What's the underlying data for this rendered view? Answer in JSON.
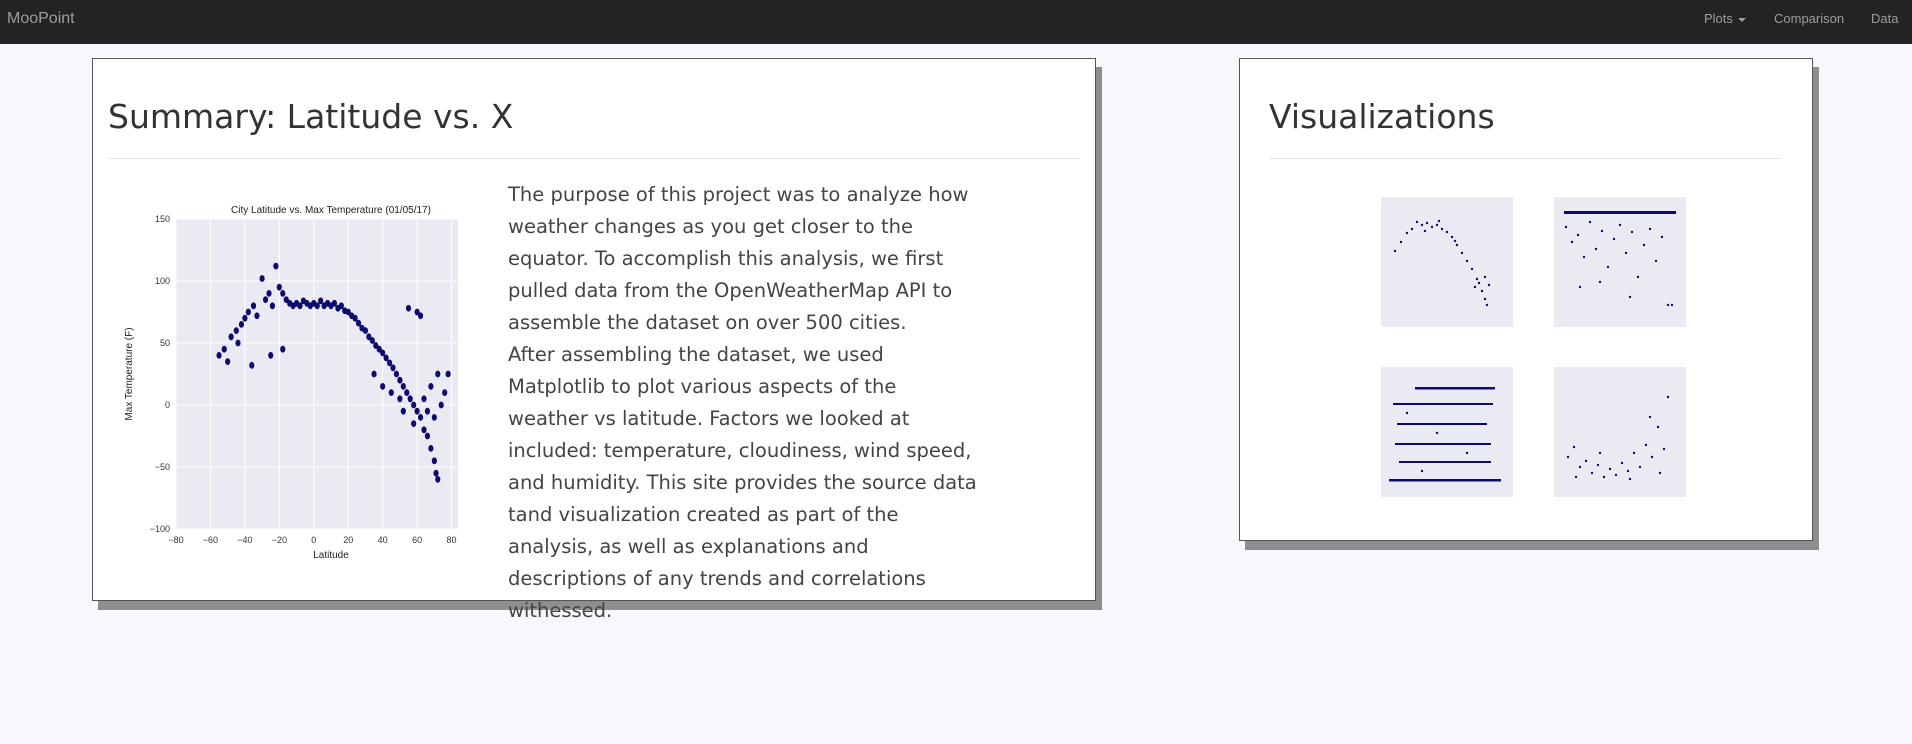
{
  "navbar": {
    "brand": "MooPoint",
    "items": [
      {
        "label": "Plots",
        "dropdown": true
      },
      {
        "label": "Comparison"
      },
      {
        "label": "Data"
      }
    ]
  },
  "summary": {
    "title": "Summary: Latitude vs. X",
    "paragraphs": [
      "The purpose of this project was to analyze how weather changes as you get closer to the equator. To accomplish this analysis, we first pulled data from the OpenWeatherMap API to assemble the dataset on over 500 cities.",
      "After assembling the dataset, we used Matplotlib to plot various aspects of the weather vs latitude. Factors we looked at included: temperature, cloudiness, wind speed, and humidity. This site provides the source data tand visualization created as part of the analysis, as well as explanations and descriptions of any trends and correlations withessed."
    ]
  },
  "visualizations": {
    "title": "Visualizations"
  },
  "colors": {
    "navbar": "#232323",
    "page_bg": "#f7f8fd",
    "plot_bg": "#eaeaf2",
    "marker": "#0d0b6e"
  },
  "chart_data": {
    "type": "scatter",
    "title": "City Latitude vs. Max Temperature (01/05/17)",
    "xlabel": "Latitude",
    "ylabel": "Max Temperature (F)",
    "xlim": [
      -80,
      100
    ],
    "ylim": [
      -100,
      150
    ],
    "xticks": [
      -80,
      -60,
      -40,
      -20,
      0,
      20,
      40,
      60,
      80,
      100
    ],
    "yticks": [
      -100,
      -50,
      0,
      50,
      100,
      150
    ],
    "grid": true,
    "points": [
      [
        -55,
        40
      ],
      [
        -52,
        45
      ],
      [
        -48,
        55
      ],
      [
        -45,
        60
      ],
      [
        -44,
        50
      ],
      [
        -42,
        65
      ],
      [
        -40,
        70
      ],
      [
        -38,
        75
      ],
      [
        -35,
        80
      ],
      [
        -33,
        72
      ],
      [
        -30,
        102
      ],
      [
        -28,
        85
      ],
      [
        -26,
        90
      ],
      [
        -24,
        80
      ],
      [
        -22,
        112
      ],
      [
        -20,
        95
      ],
      [
        -18,
        90
      ],
      [
        -16,
        85
      ],
      [
        -14,
        82
      ],
      [
        -12,
        80
      ],
      [
        -10,
        82
      ],
      [
        -8,
        80
      ],
      [
        -6,
        84
      ],
      [
        -4,
        82
      ],
      [
        -2,
        80
      ],
      [
        0,
        82
      ],
      [
        2,
        80
      ],
      [
        4,
        84
      ],
      [
        6,
        80
      ],
      [
        8,
        82
      ],
      [
        10,
        80
      ],
      [
        12,
        82
      ],
      [
        14,
        78
      ],
      [
        16,
        80
      ],
      [
        18,
        76
      ],
      [
        20,
        75
      ],
      [
        22,
        72
      ],
      [
        24,
        70
      ],
      [
        26,
        66
      ],
      [
        28,
        62
      ],
      [
        30,
        60
      ],
      [
        32,
        55
      ],
      [
        34,
        52
      ],
      [
        36,
        48
      ],
      [
        38,
        45
      ],
      [
        40,
        42
      ],
      [
        42,
        38
      ],
      [
        44,
        34
      ],
      [
        46,
        30
      ],
      [
        48,
        25
      ],
      [
        50,
        20
      ],
      [
        52,
        15
      ],
      [
        54,
        10
      ],
      [
        56,
        5
      ],
      [
        58,
        0
      ],
      [
        60,
        -5
      ],
      [
        62,
        -10
      ],
      [
        64,
        -20
      ],
      [
        66,
        -25
      ],
      [
        68,
        -35
      ],
      [
        70,
        -45
      ],
      [
        71,
        -55
      ],
      [
        72,
        -60
      ],
      [
        74,
        0
      ],
      [
        76,
        10
      ],
      [
        78,
        25
      ],
      [
        60,
        75
      ],
      [
        55,
        78
      ],
      [
        62,
        72
      ],
      [
        -50,
        35
      ],
      [
        -36,
        32
      ],
      [
        -25,
        40
      ],
      [
        -18,
        45
      ],
      [
        35,
        25
      ],
      [
        40,
        15
      ],
      [
        45,
        10
      ],
      [
        50,
        5
      ],
      [
        52,
        -5
      ],
      [
        58,
        -15
      ],
      [
        64,
        5
      ],
      [
        68,
        15
      ],
      [
        72,
        25
      ],
      [
        66,
        -5
      ],
      [
        70,
        -10
      ]
    ]
  }
}
